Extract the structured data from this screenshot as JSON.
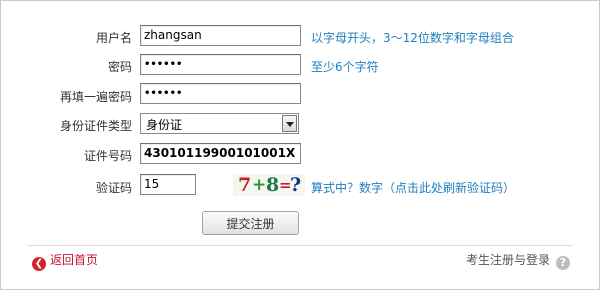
{
  "form": {
    "username": {
      "label": "用户名",
      "value": "zhangsan",
      "hint": "以字母开头，3～12位数字和字母组合"
    },
    "password": {
      "label": "密码",
      "value": "••••••",
      "hint": "至少6个字符"
    },
    "confirm_password": {
      "label": "再填一遍密码",
      "value": "••••••"
    },
    "id_type": {
      "label": "身份证件类型",
      "value": "身份证"
    },
    "id_number": {
      "label": "证件号码",
      "value": "43010119900101001X"
    },
    "captcha": {
      "label": "验证码",
      "value": "15",
      "image": {
        "c1": "7",
        "c2": "+",
        "c3": "8",
        "c4": "=",
        "c5": "?"
      },
      "hint": "算式中？数字（点击此处刷新验证码）"
    },
    "submit_label": "提交注册"
  },
  "footer": {
    "back_label": "返回首页",
    "right_label": "考生注册与登录"
  },
  "colors": {
    "hint": "#1f7fbf",
    "back_link": "#c8102e",
    "border": "#c9c9c9"
  },
  "icons": {
    "back": "back-arrow-icon",
    "help": "question-icon",
    "dropdown": "chevron-down-icon"
  }
}
